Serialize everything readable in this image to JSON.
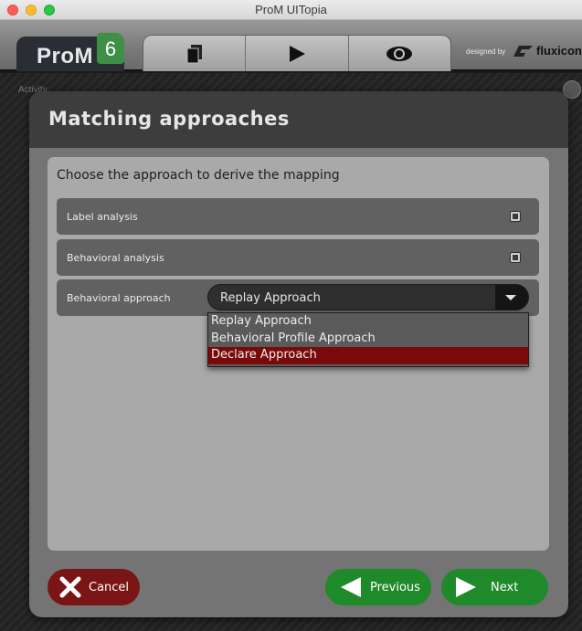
{
  "window": {
    "title": "ProM UITopia"
  },
  "toolbar": {
    "logo_text": "ProM",
    "logo_version": "6",
    "view_tabs": [
      {
        "icon": "workspace-icon"
      },
      {
        "icon": "play-icon"
      },
      {
        "icon": "eye-icon"
      }
    ],
    "credit_prefix": "designed by",
    "credit_brand": "fluxicon"
  },
  "background": {
    "activity_label": "Activity"
  },
  "dialog": {
    "title": "Matching approaches",
    "prompt": "Choose the approach to derive the mapping",
    "options": [
      {
        "label": "Label analysis"
      },
      {
        "label": "Behavioral analysis"
      }
    ],
    "approach": {
      "label": "Behavioral approach",
      "selected_value": "Replay Approach",
      "dropdown_items": [
        "Replay Approach",
        "Behavioral Profile Approach",
        "Declare Approach"
      ],
      "highlighted": "Declare Approach"
    },
    "buttons": {
      "cancel": "Cancel",
      "previous": "Previous",
      "next": "Next"
    }
  },
  "colors": {
    "cancel": "#7a1515",
    "nav": "#1f8a2a",
    "highlight": "#7a0a0a",
    "brand_green": "#3f8f47"
  }
}
